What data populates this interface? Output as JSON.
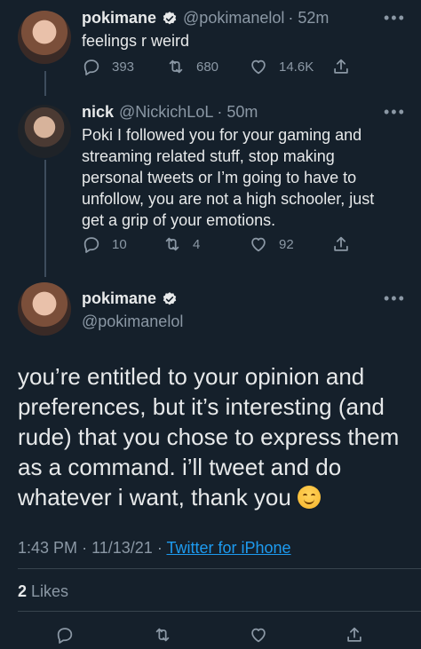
{
  "tweet1": {
    "name": "pokimane",
    "handle": "@pokimanelol",
    "time": "· 52m",
    "text": "feelings r weird",
    "replies": "393",
    "retweets": "680",
    "likes": "14.6K"
  },
  "tweet2": {
    "name": "nick",
    "handle": "@NickichLoL",
    "time": "· 50m",
    "text": "Poki I followed you for your gaming and streaming related stuff, stop making personal tweets or I’m going to have to unfollow, you are not a high schooler, just get a grip of your emotions.",
    "replies": "10",
    "retweets": "4",
    "likes": "92"
  },
  "main_tweet": {
    "name": "pokimane",
    "handle": "@pokimanelol",
    "text": "you’re entitled to your opinion and preferences, but it’s interesting (and rude) that you chose to express them as a command. i’ll tweet and do whatever i want, thank you",
    "time": "1:43 PM",
    "date": "11/13/21",
    "source": "Twitter for iPhone",
    "likes_count": "2",
    "likes_label": "Likes"
  },
  "more_label": "•••",
  "colors": {
    "background": "#15202b",
    "text": "#e7e9ea",
    "muted": "#8b98a5",
    "link": "#1d9bf0"
  }
}
